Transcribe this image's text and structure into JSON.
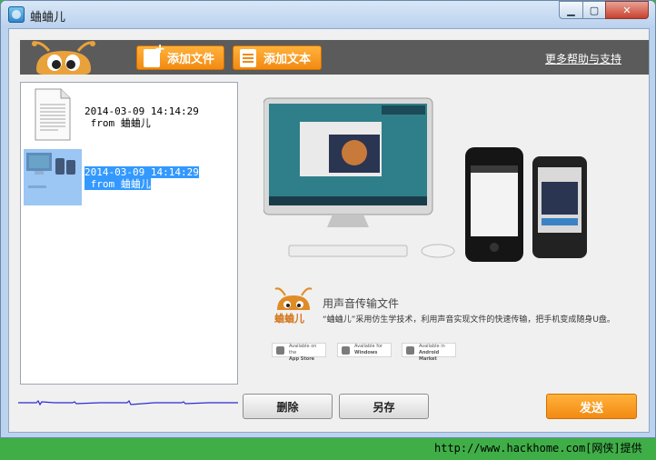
{
  "window": {
    "title": "蛐蛐儿"
  },
  "toolbar": {
    "add_file_label": "添加文件",
    "add_text_label": "添加文本",
    "help_link": "更多帮助与支持"
  },
  "files": [
    {
      "timestamp": "2014-03-09 14:14:29",
      "source": " from 蛐蛐儿",
      "icon": "document-icon"
    },
    {
      "timestamp": "2014-03-09 14:14:29",
      "source": " from 蛐蛐儿",
      "icon": "image-thumbnail",
      "selected": true
    }
  ],
  "promo": {
    "brand": "蛐蛐儿",
    "title": "用声音传输文件",
    "description": "“蛐蛐儿”采用仿生学技术，利用声音实现文件的快速传输，把手机变成随身U盘。",
    "stores": [
      {
        "small": "Available on the",
        "name": "App Store"
      },
      {
        "small": "Available for",
        "name": "Windows"
      },
      {
        "small": "Available in",
        "name": "Android Market"
      }
    ]
  },
  "actions": {
    "delete_label": "删除",
    "save_as_label": "另存",
    "send_label": "发送"
  },
  "watermark": "http://www.hackhome.com[网侠]提供",
  "colors": {
    "accent": "#f5961f",
    "toolbar_bg": "#5b5b5b",
    "selection": "#3399ff"
  }
}
